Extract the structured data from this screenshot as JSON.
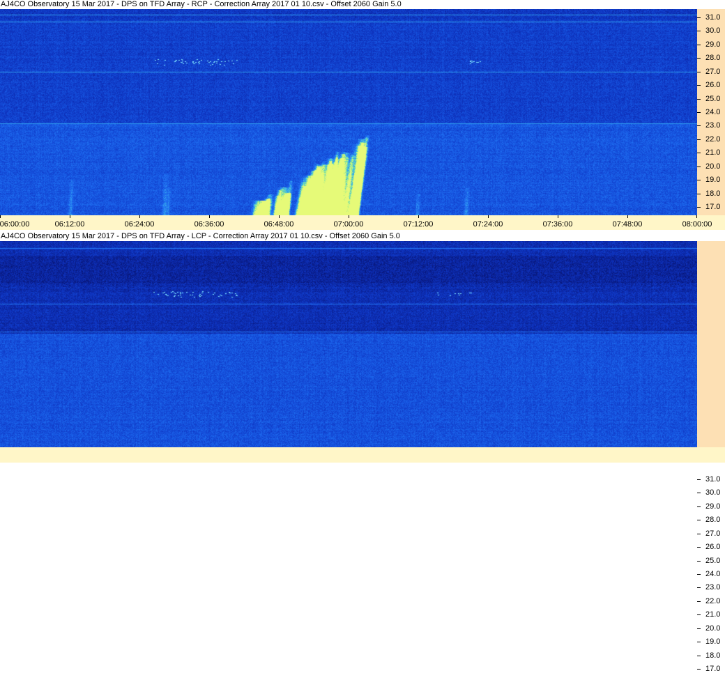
{
  "chart_data": [
    {
      "type": "heatmap",
      "title": "AJ4CO Observatory 15 Mar 2017  -  DPS on TFD Array  -  RCP  -  Correction Array 2017 01 10.csv  -  Offset 2060  Gain 5.0",
      "xlabel": "",
      "ylabel": "",
      "x_tick_labels": [
        "06:00:00",
        "06:12:00",
        "06:24:00",
        "06:36:00",
        "06:48:00",
        "07:00:00",
        "07:12:00",
        "07:24:00",
        "07:36:00",
        "07:48:00",
        "08:00:00"
      ],
      "y_tick_labels": [
        "31.0",
        "30.0",
        "29.0",
        "28.0",
        "27.0",
        "26.0",
        "25.0",
        "24.0",
        "23.0",
        "22.0",
        "21.0",
        "20.0",
        "19.0",
        "18.0",
        "17.0"
      ],
      "ylim": [
        16.4,
        31.6
      ],
      "polarization": "RCP",
      "features": [
        {
          "kind": "burst",
          "t_start": "06:44:00",
          "t_end": "07:01:00",
          "f_low": 16.5,
          "f_high": 22.0
        },
        {
          "kind": "burst",
          "t_start": "06:57:00",
          "t_end": "07:02:00",
          "f_low": 16.5,
          "f_high": 21.0
        }
      ],
      "colormap": [
        "#0a1e8c",
        "#1240d2",
        "#1f6cf0",
        "#40c8e0",
        "#b8f080"
      ]
    },
    {
      "type": "heatmap",
      "title": "AJ4CO Observatory 15 Mar 2017  -  DPS on TFD Array  -  LCP  -  Correction Array 2017 01 10.csv  -  Offset 2060  Gain 5.0",
      "xlabel": "",
      "ylabel": "",
      "x_tick_labels": [],
      "y_tick_labels": [
        "31.0",
        "30.0",
        "29.0",
        "28.0",
        "27.0",
        "26.0",
        "25.0",
        "24.0",
        "23.0",
        "22.0",
        "21.0",
        "20.0",
        "19.0",
        "18.0",
        "17.0"
      ],
      "ylim": [
        16.4,
        31.6
      ],
      "polarization": "LCP",
      "features": [],
      "colormap": [
        "#0a1e8c",
        "#1240d2",
        "#1f6cf0",
        "#40c8e0",
        "#b8f080"
      ]
    }
  ]
}
